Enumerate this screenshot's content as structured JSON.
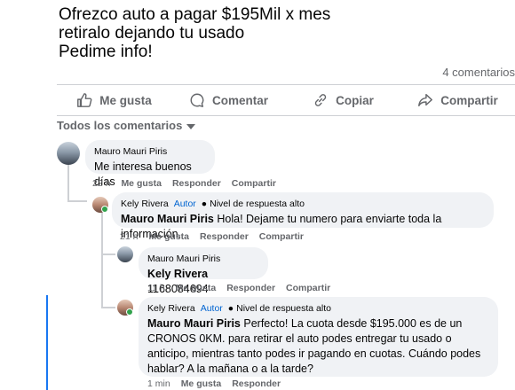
{
  "post": {
    "lines": [
      "Ofrezco auto a pagar $195Mil x mes",
      "retiralo dejando tu usado",
      "Pedime info!"
    ],
    "comment_count": "4 comentarios"
  },
  "actions": {
    "like": "Me gusta",
    "comment": "Comentar",
    "copy": "Copiar",
    "share": "Compartir"
  },
  "filter": {
    "label": "Todos los comentarios"
  },
  "comments": [
    {
      "author": "Mauro Mauri Piris",
      "text": "Me interesa buenos días",
      "time": "22 h",
      "like": "Me gusta",
      "reply": "Responder",
      "share": "Compartir"
    },
    {
      "author": "Kely Rivera",
      "author_badge": "Autor",
      "response_badge": "Nivel de respuesta alto",
      "mention": "Mauro Mauri Piris",
      "text": " Hola! Dejame tu numero para enviarte toda la información.",
      "time": "21 h",
      "like": "Me gusta",
      "reply": "Responder",
      "share": "Compartir"
    },
    {
      "author": "Mauro Mauri Piris",
      "mention": "Kely Rivera",
      "text": " 1168084694",
      "time": "11 h",
      "like": "Me gusta",
      "reply": "Responder",
      "share": "Compartir"
    },
    {
      "author": "Kely Rivera",
      "author_badge": "Autor",
      "response_badge": "Nivel de respuesta alto",
      "mention": "Mauro Mauri Piris",
      "text": " Perfecto! La cuota desde $195.000 es de un CRONOS 0KM. para retirar el auto podes entregar tu usado o anticipo, mientras tanto podes ir pagando en cuotas. Cuándo podes hablar? A la mañana o a la tarde?",
      "time": "1 min",
      "like": "Me gusta",
      "reply": "Responder"
    }
  ]
}
